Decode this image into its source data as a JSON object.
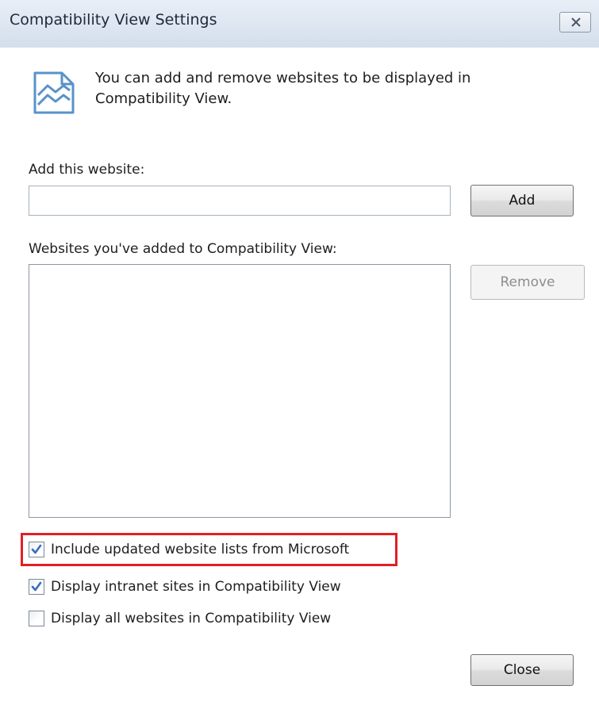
{
  "window": {
    "title": "Compatibility View Settings",
    "close_icon": "close-x-icon"
  },
  "intro": {
    "icon": "compatibility-view-icon",
    "text": "You can add and remove websites to be displayed in Compatibility View."
  },
  "add_section": {
    "label": "Add this website:",
    "input_value": "",
    "add_button": "Add"
  },
  "list_section": {
    "label": "Websites you've added to Compatibility View:",
    "items": [],
    "remove_button": "Remove",
    "remove_enabled": false
  },
  "options": [
    {
      "label": "Include updated website lists from Microsoft",
      "checked": true
    },
    {
      "label": "Display intranet sites in Compatibility View",
      "checked": true
    },
    {
      "label": "Display all websites in Compatibility View",
      "checked": false
    }
  ],
  "footer": {
    "close_button": "Close"
  },
  "colors": {
    "highlight": "#e21e26",
    "titlebar": "#dde6f1",
    "check": "#3b6bbd"
  }
}
